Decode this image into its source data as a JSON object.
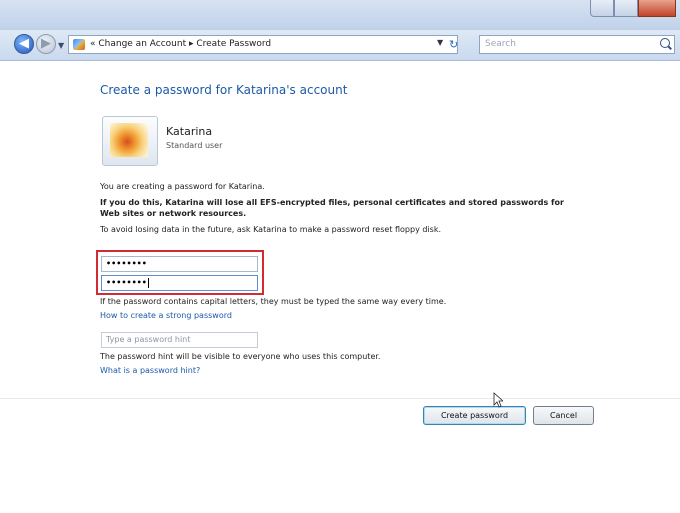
{
  "window": {
    "caption_buttons": [
      "minimize",
      "maximize",
      "close"
    ]
  },
  "navigation": {
    "breadcrumb": "« Change an Account ▸ Create Password",
    "refresh_icon": "refresh-icon",
    "search_placeholder": "Search"
  },
  "page": {
    "heading": "Create a password for Katarina's account",
    "user": {
      "name": "Katarina",
      "type": "Standard user"
    },
    "info_text": "You are creating a password for Katarina.",
    "warning_text_line1": "If you do this, Katarina will lose all EFS-encrypted files, personal certificates and stored passwords for",
    "warning_text_line2": "Web sites or network resources.",
    "advice_text": "To avoid losing data in the future, ask Katarina to make a password reset floppy disk.",
    "new_password_value": "••••••••",
    "confirm_password_value": "••••••••",
    "caps_note": "If the password contains capital letters, they must be typed the same way every time.",
    "strong_password_link": "How to create a strong password",
    "hint_placeholder": "Type a password hint",
    "hint_note": "The password hint will be visible to everyone who uses this computer.",
    "hint_link": "What is a password hint?"
  },
  "buttons": {
    "create_password": "Create password",
    "cancel": "Cancel"
  },
  "colors": {
    "link": "#1c5aa8",
    "highlight_border": "#d22b34"
  }
}
